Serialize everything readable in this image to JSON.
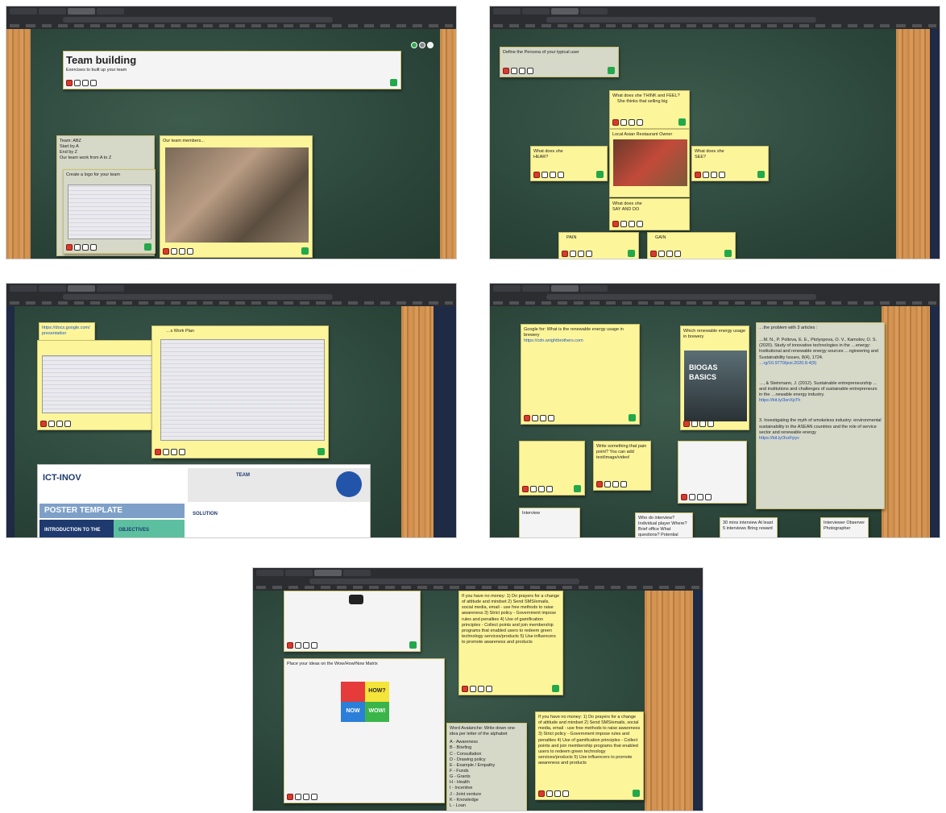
{
  "panel1": {
    "title": "Team building",
    "subtitle": "Exercises to built up your team",
    "team_note": [
      "Team: ABZ",
      "Start by A",
      "End by Z",
      "Our team work from A to Z"
    ],
    "logo_note": "Create a logo for your team",
    "members_note": "Our team members..."
  },
  "panel2": {
    "header_note": "Define the Persona of your typical user",
    "think_note": "What does she THINK and FEEL?",
    "think_bullet": "She thinks that selling big",
    "center_note": "Local Asian Restaurant Owner",
    "hear_note": "What does she HEAR?",
    "see_note": "What does she SEE?",
    "say_note": "What does she SAY AND DO",
    "pain": "PAIN",
    "gain": "GAIN"
  },
  "panel3": {
    "link_note": "https://docs.google.com/presentation",
    "plan_note": "…s Work Plan",
    "poster_logo": "ICT-INOV",
    "poster_title": "POSTER TEMPLATE",
    "poster_intro": "INTRODUCTION TO THE",
    "poster_objectives": "OBJECTIVES",
    "poster_team": "TEAM",
    "poster_solution": "SOLUTION"
  },
  "panel4": {
    "question_note": "Google for: What is the renewable energy usage in brewery",
    "link": "https://cdn.wrightbrothers.com",
    "biogas": "BIOGAS BASICS",
    "brewery_note": "Which renewable energy usage in brewery",
    "article_note": "…the problem with 3 articles :",
    "article_1": "…M. N., P. Poltova, E. E., Ptolyopova, O. V., Kamolov, O. S. (2020). Study of innovative technologies in the …energy: Institutional and renewable energy sources …ngineering and Sustainability Issues, 8(4), 1724.",
    "article_1_link": "…rg/10.9770/jesi.2020.8.4(9)",
    "article_2": "…, & Steinmann, J. (2012). Sustainable entrepreneurship …and institutions and challenges of sustainable entrepreneurs in the …newable energy industry.",
    "article_2_link": "https://bit.ly/3snXpTh",
    "article_3": "3. Investigating the myth of smokeless industry: environmental sustainability in the ASEAN countries and the role of service sector and renewable energy",
    "article_3_link": "https://bit.ly/3vzFpyv",
    "think_note": "Write something that pain point? You can add text/image/video!",
    "interview": "Interview",
    "who_interview": "Who do interview? Individual player Where? Brief office What questions? Potential",
    "interview_plan": "30 mins interview At least 5 interviews Bring reward",
    "roles": "Interviewer Observer Photographer"
  },
  "panel5": {
    "matrix_title": "Place your ideas on the Wow/How/Now Matrix",
    "how": "HOW?",
    "now": "NOW",
    "wow": "WOW!",
    "money_note": "If you have no money: 1) Do prayers for a change of attitude and mindset 2) Send SMS/emails, social media, email - use free methods to raise awareness 3) Strict policy - Government impose rules and penalties 4) Use of gamification principles - Collect points and join membership programs that enabled users to redeem green technology services/products 5) Use influencers to promote awareness and products",
    "money_note_2": "If you have no money: 1) Do prayers for a change of attitude and mindset 2) Send SMS/emails, social media, email - use free methods to raise awareness 3) Strict policy - Government impose rules and penalties 4) Use of gamification principles - Collect points and join membership programs that enabled users to redeem green technology services/products 5) Use influencers to promote awareness and products",
    "word_note": "Word Avalanche: Write down one idea per letter of the alphabet",
    "letters": [
      "A - Awareness",
      "B - Briefing",
      "C - Consultation",
      "D - Drawing policy",
      "E - Example / Empathy",
      "F - Funds",
      "G - Grants",
      "H - Health",
      "I - Incentive",
      "J - Joint venture",
      "K - Knowledge",
      "L - Loan"
    ]
  }
}
